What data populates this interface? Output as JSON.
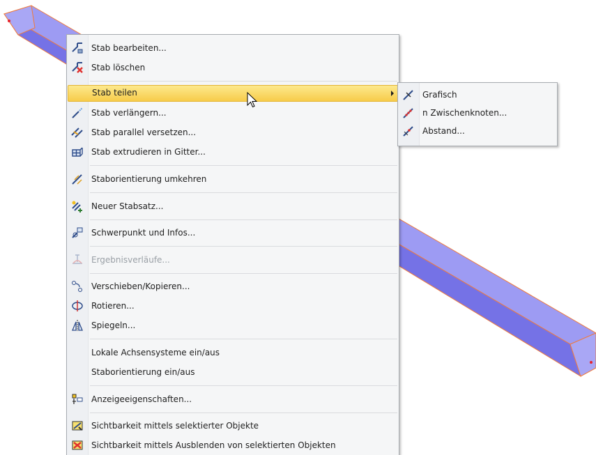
{
  "context_menu": {
    "items": [
      {
        "label": "Stab bearbeiten...",
        "icon": "edit-member-icon"
      },
      {
        "label": "Stab löschen",
        "icon": "delete-member-icon"
      },
      {
        "label": "Stab teilen",
        "icon": "none",
        "state": "highlighted",
        "submenu": true
      },
      {
        "label": "Stab verlängern...",
        "icon": "extend-member-icon"
      },
      {
        "label": "Stab parallel versetzen...",
        "icon": "offset-parallel-icon"
      },
      {
        "label": "Stab extrudieren in Gitter...",
        "icon": "extrude-grid-icon"
      },
      {
        "label": "Staborientierung umkehren",
        "icon": "reverse-orientation-icon"
      },
      {
        "label": "Neuer Stabsatz...",
        "icon": "new-member-set-icon"
      },
      {
        "label": "Schwerpunkt und Infos...",
        "icon": "centroid-info-icon"
      },
      {
        "label": "Ergebnisverläufe...",
        "icon": "result-diagrams-icon",
        "state": "disabled"
      },
      {
        "label": "Verschieben/Kopieren...",
        "icon": "move-copy-icon"
      },
      {
        "label": "Rotieren...",
        "icon": "rotate-icon"
      },
      {
        "label": "Spiegeln...",
        "icon": "mirror-icon"
      },
      {
        "label": "Lokale Achsensysteme ein/aus",
        "icon": "none"
      },
      {
        "label": "Staborientierung ein/aus",
        "icon": "none"
      },
      {
        "label": "Anzeigeeigenschaften...",
        "icon": "display-properties-icon"
      },
      {
        "label": "Sichtbarkeit mittels selektierter Objekte",
        "icon": "visibility-selected-icon"
      },
      {
        "label": "Sichtbarkeit mittels Ausblenden von selektierten Objekten",
        "icon": "visibility-hide-selected-icon"
      }
    ]
  },
  "submenu": {
    "items": [
      {
        "label": "Grafisch",
        "icon": "divide-graphic-icon"
      },
      {
        "label": "n Zwischenknoten...",
        "icon": "divide-n-nodes-icon"
      },
      {
        "label": "Abstand...",
        "icon": "divide-distance-icon"
      }
    ]
  },
  "colors": {
    "highlight": "#f7cc4a",
    "member_fill": "#8f8df0",
    "member_edge": "#f07a3c",
    "node": "#e8232d"
  }
}
